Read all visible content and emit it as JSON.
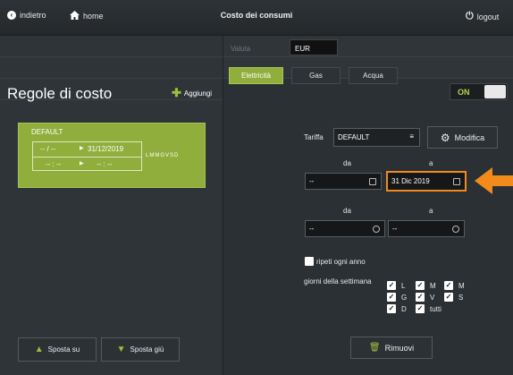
{
  "topbar": {
    "back_label": "indietro",
    "home_label": "home",
    "title": "Costo dei consumi",
    "logout_label": "logout"
  },
  "currency": {
    "label": "Valuta",
    "value": "EUR"
  },
  "tabs": [
    {
      "label": "Elettricità",
      "active": true
    },
    {
      "label": "Gas",
      "active": false
    },
    {
      "label": "Acqua",
      "active": false
    }
  ],
  "toggle": {
    "label": "ON",
    "state": true
  },
  "left_panel": {
    "title": "Regole di costo",
    "add_label": "Aggiungi",
    "rule": {
      "name": "DEFAULT",
      "date_from": "-- / -- ",
      "date_to": "31/12/2019",
      "time_from": "-- : --",
      "time_to": "-- : --",
      "days": "LMMGVSD"
    },
    "move_up_label": "Sposta su",
    "move_down_label": "Sposta giù"
  },
  "form": {
    "tariff_label": "Tariffa",
    "tariff_value": "DEFAULT",
    "edit_label": "Modifica",
    "date_from_label": "da",
    "date_to_label": "a",
    "date_from_value": "--",
    "date_to_value": "31 Dic 2019",
    "time_from_label": "da",
    "time_to_label": "a",
    "time_from_value": "--",
    "time_to_value": "--",
    "repeat_label": "ripeti ogni anno",
    "days_label": "giorni della settimana",
    "days": [
      {
        "label": "L",
        "checked": true
      },
      {
        "label": "M",
        "checked": true
      },
      {
        "label": "M",
        "checked": true
      },
      {
        "label": "G",
        "checked": true
      },
      {
        "label": "V",
        "checked": true
      },
      {
        "label": "S",
        "checked": true
      },
      {
        "label": "D",
        "checked": true
      },
      {
        "label": "tutti",
        "checked": true
      }
    ],
    "remove_label": "Rimuovi"
  },
  "colors": {
    "accent_green": "#8fae3c",
    "highlight_orange": "#f28a1c",
    "background": "#2b3034"
  }
}
